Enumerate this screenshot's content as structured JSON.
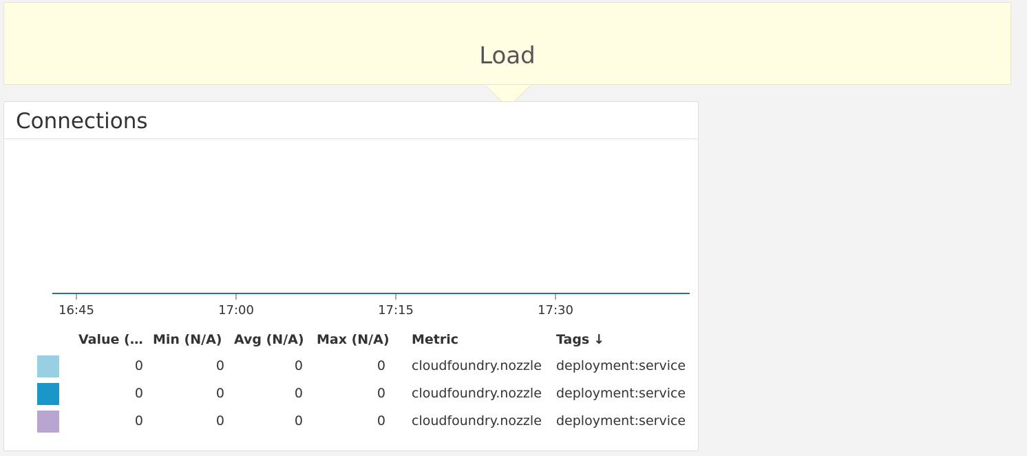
{
  "group": {
    "title": "Load"
  },
  "widget": {
    "title": "Connections"
  },
  "chart_data": {
    "type": "line",
    "x_ticks": [
      "16:45",
      "17:00",
      "17:15",
      "17:30"
    ],
    "series": [
      {
        "color": "#99cfe3",
        "values": [
          0,
          0,
          0,
          0,
          0
        ]
      },
      {
        "color": "#1a96c9",
        "values": [
          0,
          0,
          0,
          0,
          0
        ]
      },
      {
        "color": "#b8a5d0",
        "values": [
          0,
          0,
          0,
          0,
          0
        ]
      }
    ],
    "line_color": "#2e6f8e",
    "grid": false
  },
  "legend": {
    "columns": {
      "value": "Value (N/A)",
      "min": "Min (N/A)",
      "avg": "Avg (N/A)",
      "max": "Max (N/A)",
      "metric": "Metric",
      "tags": "Tags",
      "tags_sort": "↓"
    },
    "rows": [
      {
        "color": "#99cfe3",
        "value": "0",
        "min": "0",
        "avg": "0",
        "max": "0",
        "metric": "cloudfoundry.nozzle",
        "tags": "deployment:service"
      },
      {
        "color": "#1a96c9",
        "value": "0",
        "min": "0",
        "avg": "0",
        "max": "0",
        "metric": "cloudfoundry.nozzle",
        "tags": "deployment:service"
      },
      {
        "color": "#b8a5d0",
        "value": "0",
        "min": "0",
        "avg": "0",
        "max": "0",
        "metric": "cloudfoundry.nozzle",
        "tags": "deployment:service"
      }
    ]
  }
}
